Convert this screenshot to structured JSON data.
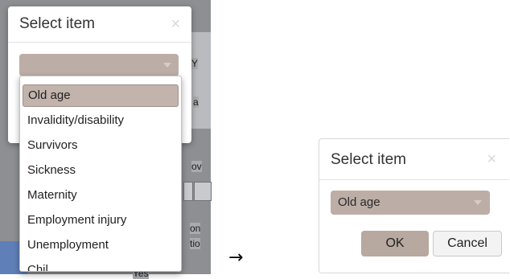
{
  "before_dialog": {
    "title": "Select item",
    "close_glyph": "×",
    "dropdown_options": [
      "Old age",
      "Invalidity/disability",
      "Survivors",
      "Sickness",
      "Maternity",
      "Employment injury",
      "Unemployment",
      "Chil"
    ],
    "highlighted_option": "Old age",
    "background_fragments": [
      "Y",
      "a",
      "ov",
      "on",
      "tio",
      "Yes"
    ]
  },
  "transition_arrow": "→",
  "after_dialog": {
    "title": "Select item",
    "close_glyph": "×",
    "selected_value": "Old age",
    "ok_label": "OK",
    "cancel_label": "Cancel"
  },
  "colors": {
    "select_fill": "#bcaea6",
    "highlight_fill": "#c2b4ac",
    "ok_button": "#b7a8a0",
    "overlay": "#8d8f92"
  }
}
